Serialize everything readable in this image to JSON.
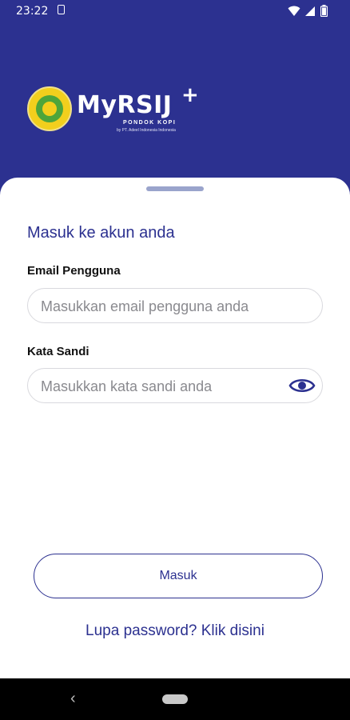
{
  "status": {
    "time": "23:22"
  },
  "brand": {
    "name": "MyRSIJ",
    "plus": "+",
    "subtitle": "PONDOK KOPI",
    "tagline": "by PT. Adeel Indonesia Indonesia"
  },
  "login": {
    "title": "Masuk ke akun anda",
    "email_label": "Email Pengguna",
    "email_placeholder": "Masukkan email pengguna anda",
    "email_value": "",
    "password_label": "Kata Sandi",
    "password_placeholder": "Masukkan kata sandi anda",
    "password_value": "",
    "submit_label": "Masuk",
    "forgot_label": "Lupa password? Klik disini"
  },
  "colors": {
    "primary": "#2c3190",
    "logo_yellow": "#f2cf1d",
    "logo_green": "#4ea53a"
  },
  "icons": {
    "eye": "eye-icon",
    "wifi": "wifi-icon",
    "signal": "signal-icon",
    "battery": "battery-icon",
    "back": "back-icon",
    "home": "home-icon"
  }
}
